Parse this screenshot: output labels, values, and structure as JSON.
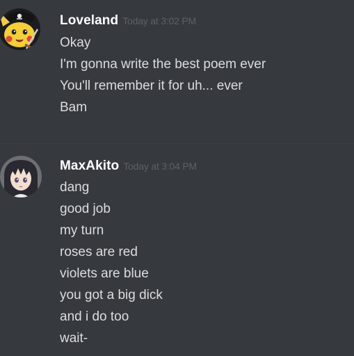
{
  "messages": [
    {
      "username": "Loveland",
      "timestamp": "Today at 3:02 PM",
      "avatar_icon": "pikachu-pirate-avatar",
      "lines": [
        "Okay",
        "I'm gonna write the best poem ever",
        "You'll remember it for uh... ever",
        "Bam"
      ]
    },
    {
      "username": "MaxAkito",
      "timestamp": "Today at 3:04 PM",
      "avatar_icon": "anime-girl-avatar",
      "lines": [
        "dang",
        "good job",
        "my turn",
        "roses are red",
        "violets are blue",
        "you got a big dick",
        "and i do too",
        "wait-"
      ]
    }
  ],
  "colors": {
    "background": "#36393e",
    "username": "#ffffff",
    "message_text": "#dcddde",
    "timestamp": "#5d6066"
  }
}
